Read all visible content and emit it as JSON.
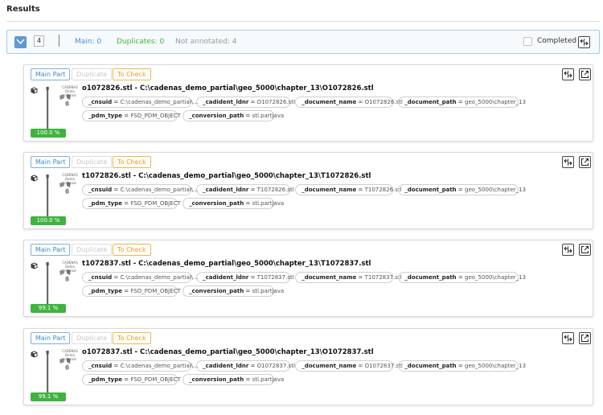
{
  "header": {
    "title": "Results"
  },
  "summary": {
    "count": "4",
    "main": "Main: 0",
    "duplicates": "Duplicates: 0",
    "not_annotated": "Not annotated: 4",
    "completed_label": "Completed"
  },
  "tags": {
    "main": "Main Part",
    "duplicate": "Duplicate",
    "check": "To Check"
  },
  "thumbnail_brand": "CADENAS Demo internal",
  "keys": {
    "cnsuid": "_cnsuid",
    "cadident": "_cadident_ldnr",
    "docname": "_document_name",
    "docpath": "_document_path",
    "pdm": "_pdm_type",
    "conv": "_conversion_path"
  },
  "cards": [
    {
      "title": "o1072826.stl - C:\\cadenas_demo_partial\\geo_5000\\chapter_13\\O1072826.stl",
      "cnsuid": "C:\\cadenas_demo_partial\\...",
      "cadident": "O1072826.stl",
      "docname": "O1072826.stl",
      "docpath": "geo_5000\\chapter_13",
      "pdm": "FSO_PDM_OBJECT",
      "conv": "stl.partjava",
      "score": "100.0 %"
    },
    {
      "title": "t1072826.stl - C:\\cadenas_demo_partial\\geo_5000\\chapter_13\\T1072826.stl",
      "cnsuid": "C:\\cadenas_demo_partial\\...",
      "cadident": "T1072826.stl",
      "docname": "T1072826.stl",
      "docpath": "geo_5000\\chapter_13",
      "pdm": "FSO_PDM_OBJECT",
      "conv": "stl.partjava",
      "score": "100.0 %"
    },
    {
      "title": "t1072837.stl - C:\\cadenas_demo_partial\\geo_5000\\chapter_13\\T1072837.stl",
      "cnsuid": "C:\\cadenas_demo_partial\\...",
      "cadident": "T1072837.stl",
      "docname": "T1072837.stl",
      "docpath": "geo_5000\\chapter_13",
      "pdm": "FSO_PDM_OBJECT",
      "conv": "stl.partjava",
      "score": "99.1 %"
    },
    {
      "title": "o1072837.stl - C:\\cadenas_demo_partial\\geo_5000\\chapter_13\\O1072837.stl",
      "cnsuid": "C:\\cadenas_demo_partial\\...",
      "cadident": "O1072837.stl",
      "docname": "O1072837.stl",
      "docpath": "geo_5000\\chapter_13",
      "pdm": "FSO_PDM_OBJECT",
      "conv": "stl.partjava",
      "score": "99.1 %"
    }
  ],
  "colors": {
    "accent": "#5c9bd1",
    "duplicates": "#4cae3a",
    "to_check": "#e59b1f",
    "score_bar": "#3eb33e"
  },
  "icons": {
    "select_all": "check-icon",
    "compare": "compare-arrows-icon",
    "open": "open-external-icon",
    "part": "cube-icon"
  }
}
